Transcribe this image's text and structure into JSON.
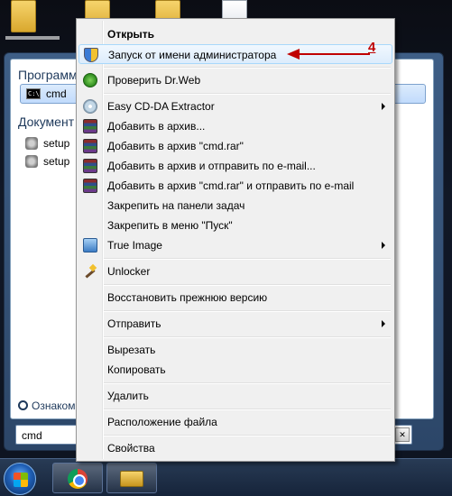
{
  "start_menu": {
    "programs_header": "Программ",
    "program_item": "cmd",
    "documents_header": "Документ",
    "doc_items": [
      "setup",
      "setup"
    ],
    "see_more": "Ознакоми",
    "search_value": "cmd"
  },
  "context_menu": {
    "items": [
      {
        "label": "Открыть",
        "bold": true
      },
      {
        "label": "Запуск от имени администратора",
        "icon": "uac-shield-icon"
      },
      {
        "label": "Проверить Dr.Web",
        "icon": "drweb-icon"
      },
      {
        "label": "Easy CD-DA Extractor",
        "icon": "cd-icon",
        "submenu": true
      },
      {
        "label": "Добавить в архив...",
        "icon": "winrar-icon"
      },
      {
        "label": "Добавить в архив \"cmd.rar\"",
        "icon": "winrar-icon"
      },
      {
        "label": "Добавить в архив и отправить по e-mail...",
        "icon": "winrar-icon"
      },
      {
        "label": "Добавить в архив \"cmd.rar\" и отправить по e-mail",
        "icon": "winrar-icon"
      },
      {
        "label": "Закрепить на панели задач"
      },
      {
        "label": "Закрепить в меню \"Пуск\""
      },
      {
        "label": "True Image",
        "icon": "true-image-icon",
        "submenu": true
      },
      {
        "label": "Unlocker",
        "icon": "unlocker-wand-icon"
      },
      {
        "label": "Восстановить прежнюю версию"
      },
      {
        "label": "Отправить",
        "submenu": true
      },
      {
        "label": "Вырезать"
      },
      {
        "label": "Копировать"
      },
      {
        "label": "Удалить"
      },
      {
        "label": "Расположение файла"
      },
      {
        "label": "Свойства"
      }
    ]
  },
  "annotation": {
    "number": "4",
    "color": "#c00000"
  }
}
